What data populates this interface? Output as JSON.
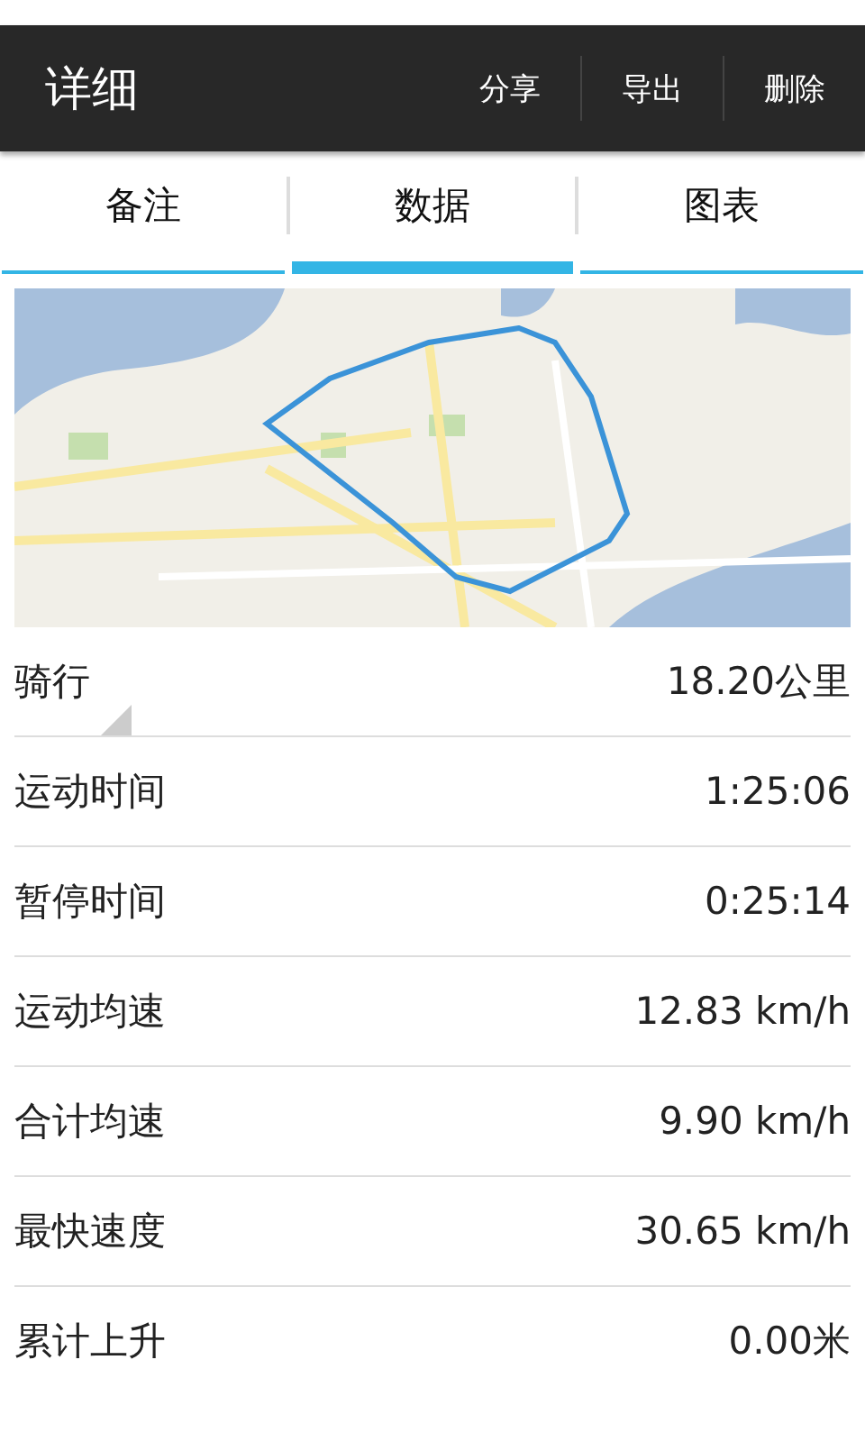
{
  "action_bar": {
    "title": "详细",
    "actions": [
      "分享",
      "导出",
      "删除"
    ]
  },
  "tabs": [
    {
      "label": "备注",
      "selected": false
    },
    {
      "label": "数据",
      "selected": true
    },
    {
      "label": "图表",
      "selected": false
    }
  ],
  "stats": [
    {
      "kind": "spinner",
      "label": "骑行",
      "value": "18.20公里"
    },
    {
      "kind": "stat",
      "label": "运动时间",
      "value": "1:25:06"
    },
    {
      "kind": "stat",
      "label": "暂停时间",
      "value": "0:25:14"
    },
    {
      "kind": "stat",
      "label": "运动均速",
      "value": "12.83 km/h"
    },
    {
      "kind": "stat",
      "label": "合计均速",
      "value": "9.90 km/h"
    },
    {
      "kind": "stat",
      "label": "最快速度",
      "value": "30.65 km/h"
    },
    {
      "kind": "stat",
      "label": "累计上升",
      "value": "0.00米"
    }
  ]
}
